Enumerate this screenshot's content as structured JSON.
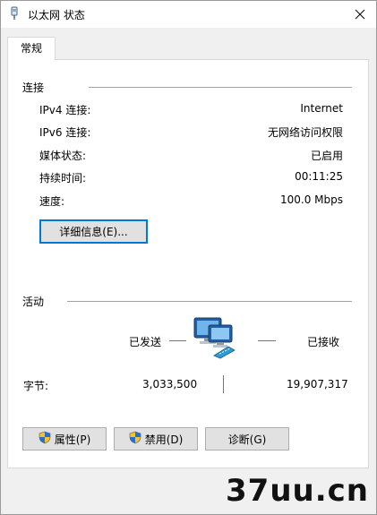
{
  "window": {
    "title": "以太网 状态"
  },
  "tabs": [
    {
      "label": "常规"
    }
  ],
  "connection": {
    "group_label": "连接",
    "rows": [
      {
        "label": "IPv4 连接:",
        "value": "Internet"
      },
      {
        "label": "IPv6 连接:",
        "value": "无网络访问权限"
      },
      {
        "label": "媒体状态:",
        "value": "已启用"
      },
      {
        "label": "持续时间:",
        "value": "00:11:25"
      },
      {
        "label": "速度:",
        "value": "100.0 Mbps"
      }
    ],
    "details_button": "详细信息(E)..."
  },
  "activity": {
    "group_label": "活动",
    "sent_label": "已发送",
    "received_label": "已接收",
    "bytes_label": "字节:",
    "bytes_sent": "3,033,500",
    "bytes_received": "19,907,317"
  },
  "buttons": {
    "properties": "属性(P)",
    "disable": "禁用(D)",
    "diagnose": "诊断(G)"
  },
  "watermark": "37uu.cn",
  "icons": {
    "title": "ethernet-plug-icon",
    "close": "close-icon",
    "network": "network-activity-icon",
    "shield": "uac-shield-icon"
  }
}
